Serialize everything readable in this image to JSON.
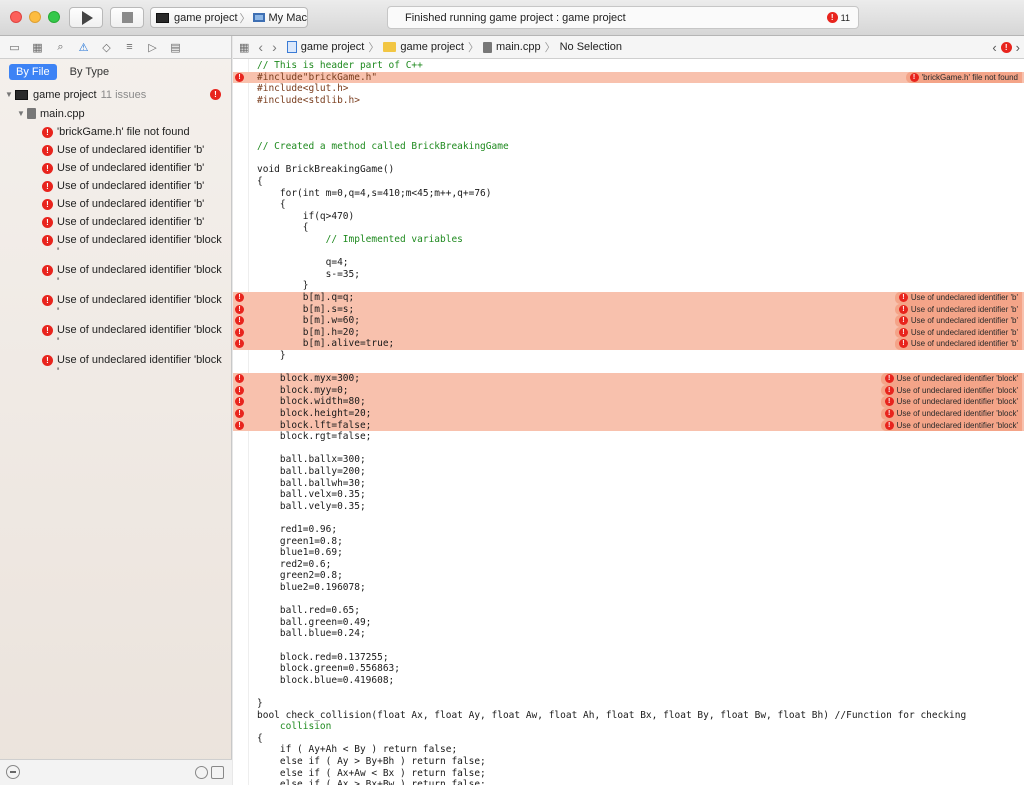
{
  "toolbar": {
    "scheme_project": "game project",
    "scheme_sep": "〉",
    "scheme_device": "My Mac",
    "activity_text": "Finished running game project : game project",
    "issue_count": "11"
  },
  "navigator": {
    "scope_by_file": "By File",
    "scope_by_type": "By Type",
    "project_name": "game project",
    "project_issue_count": "11 issues",
    "file_name": "main.cpp",
    "issues": [
      "'brickGame.h' file not found",
      "Use of undeclared identifier 'b'",
      "Use of undeclared identifier 'b'",
      "Use of undeclared identifier 'b'",
      "Use of undeclared identifier 'b'",
      "Use of undeclared identifier 'b'",
      "Use of undeclared identifier 'block '",
      "Use of undeclared identifier 'block '",
      "Use of undeclared identifier 'block '",
      "Use of undeclared identifier 'block '",
      "Use of undeclared identifier 'block '"
    ]
  },
  "jumpbar": {
    "crumb_1": "game project",
    "crumb_2": "game project",
    "crumb_3": "main.cpp",
    "crumb_4": "No Selection"
  },
  "editor": {
    "lines": [
      {
        "t": "// This is header part of C++",
        "c": "com"
      },
      {
        "t": "#include\"brickGame.h\"",
        "c": "pp",
        "err": true,
        "msg": "'brickGame.h' file not found"
      },
      {
        "t": "#include<glut.h>",
        "c": "pp"
      },
      {
        "t": "#include<stdlib.h>",
        "c": "pp"
      },
      {
        "t": "",
        "c": "plain"
      },
      {
        "t": "",
        "c": "plain"
      },
      {
        "t": "",
        "c": "plain"
      },
      {
        "t": "// Created a method called BrickBreakingGame",
        "c": "com"
      },
      {
        "t": "",
        "c": "plain"
      },
      {
        "t": "void BrickBreakingGame()",
        "c": "plain"
      },
      {
        "t": "{",
        "c": "plain"
      },
      {
        "t": "    for(int m=0,q=4,s=410;m<45;m++,q+=76)",
        "c": "plain"
      },
      {
        "t": "    {",
        "c": "plain"
      },
      {
        "t": "        if(q>470)",
        "c": "plain"
      },
      {
        "t": "        {",
        "c": "plain"
      },
      {
        "t": "            // Implemented variables",
        "c": "com"
      },
      {
        "t": "",
        "c": "plain"
      },
      {
        "t": "            q=4;",
        "c": "plain"
      },
      {
        "t": "            s-=35;",
        "c": "plain"
      },
      {
        "t": "        }",
        "c": "plain"
      },
      {
        "t": "        b[m].q=q;",
        "c": "plain",
        "err": true,
        "msg": "Use of undeclared identifier 'b'"
      },
      {
        "t": "        b[m].s=s;",
        "c": "plain",
        "err": true,
        "msg": "Use of undeclared identifier 'b'"
      },
      {
        "t": "        b[m].w=60;",
        "c": "plain",
        "err": true,
        "msg": "Use of undeclared identifier 'b'"
      },
      {
        "t": "        b[m].h=20;",
        "c": "plain",
        "err": true,
        "msg": "Use of undeclared identifier 'b'"
      },
      {
        "t": "        b[m].alive=true;",
        "c": "plain",
        "err": true,
        "msg": "Use of undeclared identifier 'b'"
      },
      {
        "t": "    }",
        "c": "plain"
      },
      {
        "t": "",
        "c": "plain"
      },
      {
        "t": "    block.myx=300;",
        "c": "plain",
        "err": true,
        "msg": "Use of undeclared identifier 'block'"
      },
      {
        "t": "    block.myy=0;",
        "c": "plain",
        "err": true,
        "msg": "Use of undeclared identifier 'block'"
      },
      {
        "t": "    block.width=80;",
        "c": "plain",
        "err": true,
        "msg": "Use of undeclared identifier 'block'"
      },
      {
        "t": "    block.height=20;",
        "c": "plain",
        "err": true,
        "msg": "Use of undeclared identifier 'block'"
      },
      {
        "t": "    block.lft=false;",
        "c": "plain",
        "err": true,
        "msg": "Use of undeclared identifier 'block'"
      },
      {
        "t": "    block.rgt=false;",
        "c": "plain"
      },
      {
        "t": "",
        "c": "plain"
      },
      {
        "t": "    ball.ballx=300;",
        "c": "plain"
      },
      {
        "t": "    ball.bally=200;",
        "c": "plain"
      },
      {
        "t": "    ball.ballwh=30;",
        "c": "plain"
      },
      {
        "t": "    ball.velx=0.35;",
        "c": "plain"
      },
      {
        "t": "    ball.vely=0.35;",
        "c": "plain"
      },
      {
        "t": "",
        "c": "plain"
      },
      {
        "t": "    red1=0.96;",
        "c": "plain"
      },
      {
        "t": "    green1=0.8;",
        "c": "plain"
      },
      {
        "t": "    blue1=0.69;",
        "c": "plain"
      },
      {
        "t": "    red2=0.6;",
        "c": "plain"
      },
      {
        "t": "    green2=0.8;",
        "c": "plain"
      },
      {
        "t": "    blue2=0.196078;",
        "c": "plain"
      },
      {
        "t": "",
        "c": "plain"
      },
      {
        "t": "    ball.red=0.65;",
        "c": "plain"
      },
      {
        "t": "    ball.green=0.49;",
        "c": "plain"
      },
      {
        "t": "    ball.blue=0.24;",
        "c": "plain"
      },
      {
        "t": "",
        "c": "plain"
      },
      {
        "t": "    block.red=0.137255;",
        "c": "plain"
      },
      {
        "t": "    block.green=0.556863;",
        "c": "plain"
      },
      {
        "t": "    block.blue=0.419608;",
        "c": "plain"
      },
      {
        "t": "",
        "c": "plain"
      },
      {
        "t": "}",
        "c": "plain"
      },
      {
        "t": "bool check_collision(float Ax, float Ay, float Aw, float Ah, float Bx, float By, float Bw, float Bh) //Function for checking",
        "c": "plain"
      },
      {
        "t": "    collision",
        "c": "com"
      },
      {
        "t": "{",
        "c": "plain"
      },
      {
        "t": "    if ( Ay+Ah < By ) return false;",
        "c": "plain"
      },
      {
        "t": "    else if ( Ay > By+Bh ) return false;",
        "c": "plain"
      },
      {
        "t": "    else if ( Ax+Aw < Bx ) return false;",
        "c": "plain"
      },
      {
        "t": "    else if ( Ax > Bx+Bw ) return false;",
        "c": "plain"
      }
    ]
  }
}
